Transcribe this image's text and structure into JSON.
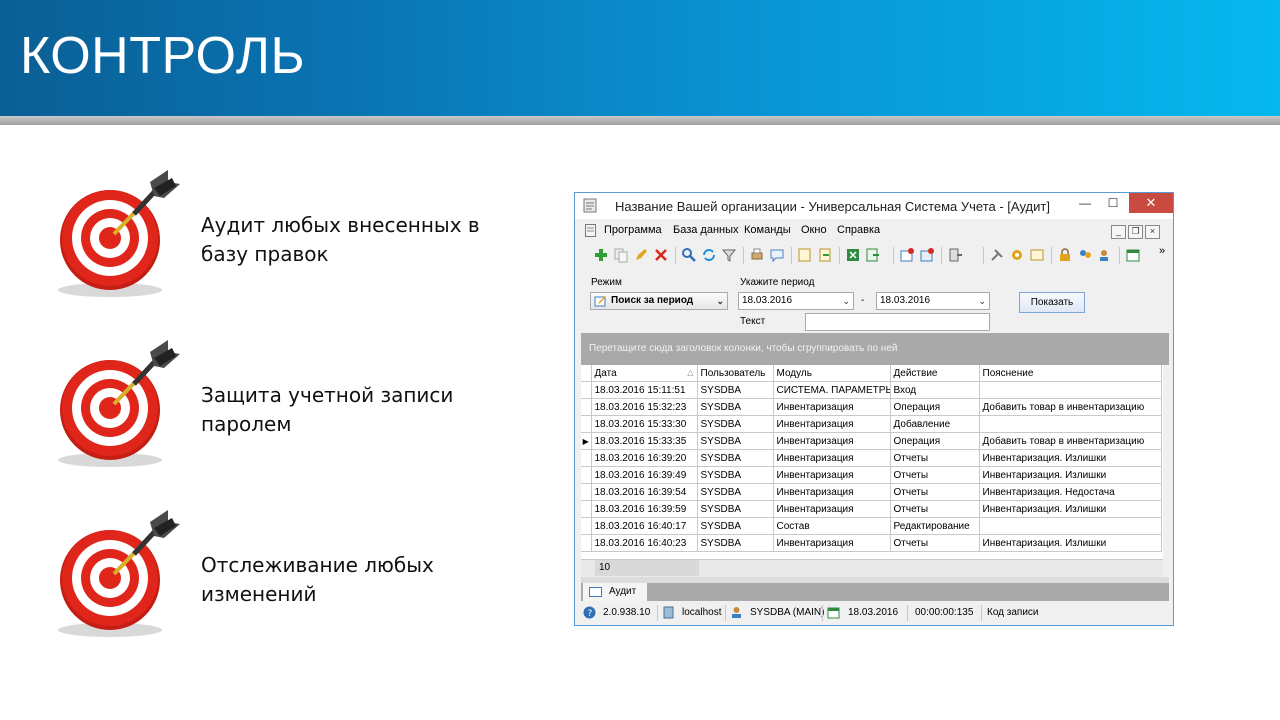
{
  "slide": {
    "title": "КОНТРОЛЬ",
    "bullets": [
      {
        "line1": "Аудит любых внесенных в",
        "line2": "базу правок"
      },
      {
        "line1": "Защита учетной записи",
        "line2": "паролем"
      },
      {
        "line1": "Отслеживание любых",
        "line2": "изменений"
      }
    ]
  },
  "window": {
    "title": "Название Вашей организации - Универсальная Система Учета - [Аудит]",
    "controls": {
      "minimize": "—",
      "maximize": "☐",
      "close": "✕"
    },
    "menu": [
      "Программа",
      "База данных",
      "Команды",
      "Окно",
      "Справка"
    ],
    "mdi_controls": {
      "minimize": "_",
      "restore": "❐",
      "close": "×"
    },
    "toolbar_more": "»",
    "filter": {
      "mode_label": "Режим",
      "mode_value": "Поиск за период",
      "period_label": "Укажите период",
      "date_from": "18.03.2016",
      "date_sep": "-",
      "date_to": "18.03.2016",
      "show_button": "Показать",
      "text_label": "Текст",
      "text_value": ""
    },
    "group_panel_hint": "Перетащите сюда заголовок колонки, чтобы сгруппировать по ней",
    "grid": {
      "columns": [
        "Дата",
        "Пользователь",
        "Модуль",
        "Действие",
        "Пояснение"
      ],
      "rows": [
        [
          "18.03.2016 15:11:51",
          "SYSDBA",
          "СИСТЕМА. ПАРАМЕТРЫ",
          "Вход",
          ""
        ],
        [
          "18.03.2016 15:32:23",
          "SYSDBA",
          "Инвентаризация",
          "Операция",
          "Добавить товар в инвентаризацию"
        ],
        [
          "18.03.2016 15:33:30",
          "SYSDBA",
          "Инвентаризация",
          "Добавление",
          ""
        ],
        [
          "18.03.2016 15:33:35",
          "SYSDBA",
          "Инвентаризация",
          "Операция",
          "Добавить товар в инвентаризацию"
        ],
        [
          "18.03.2016 16:39:20",
          "SYSDBA",
          "Инвентаризация",
          "Отчеты",
          "Инвентаризация. Излишки"
        ],
        [
          "18.03.2016 16:39:49",
          "SYSDBA",
          "Инвентаризация",
          "Отчеты",
          "Инвентаризация. Излишки"
        ],
        [
          "18.03.2016 16:39:54",
          "SYSDBA",
          "Инвентаризация",
          "Отчеты",
          "Инвентаризация. Недостача"
        ],
        [
          "18.03.2016 16:39:59",
          "SYSDBA",
          "Инвентаризация",
          "Отчеты",
          "Инвентаризация. Излишки"
        ],
        [
          "18.03.2016 16:40:17",
          "SYSDBA",
          "Состав",
          "Редактирование",
          ""
        ],
        [
          "18.03.2016 16:40:23",
          "SYSDBA",
          "Инвентаризация",
          "Отчеты",
          "Инвентаризация. Излишки"
        ]
      ],
      "current_row_index": 3,
      "row_count": "10"
    },
    "tab": "Аудит",
    "status": {
      "version": "2.0.938.10",
      "server": "localhost",
      "user": "SYSDBA (MAIN)",
      "date": "18.03.2016",
      "elapsed": "00:00:00:135",
      "record_code": "Код записи"
    }
  },
  "colors": {
    "banner_dark": "#0a5f95",
    "banner_light": "#05b8ee",
    "target_red": "#d8261c",
    "close_button": "#c94a3f"
  }
}
